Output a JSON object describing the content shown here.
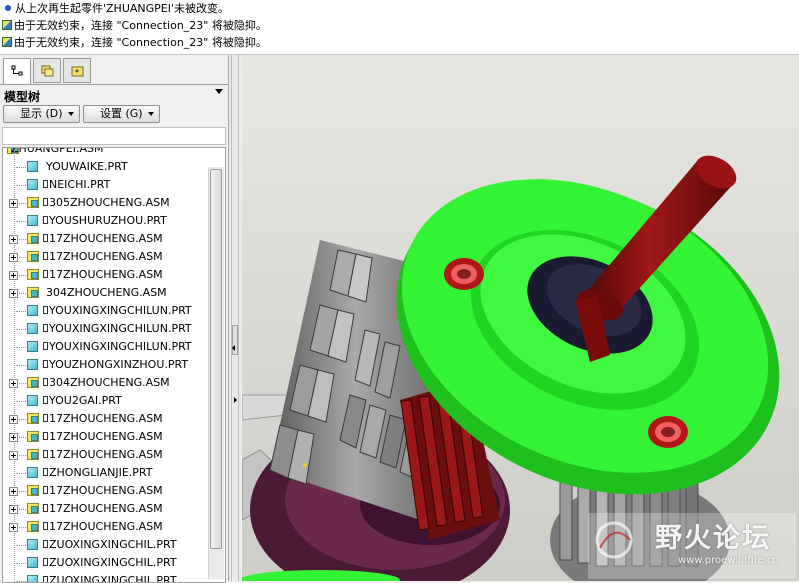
{
  "messages": [
    {
      "text": "从上次再生起零件'ZHUANGPEI'未被改变。",
      "icon": "info-dot-icon"
    },
    {
      "text": "由于无效约束，连接 \"Connection_23\" 将被隐抑。",
      "icon": "warning-icon"
    },
    {
      "text": "由于无效约束，连接 \"Connection_23\" 将被隐抑。",
      "icon": "warning-icon"
    }
  ],
  "navigator": {
    "tabs": [
      {
        "icon": "model-tree-icon",
        "active": true
      },
      {
        "icon": "folder-browser-icon",
        "active": false
      },
      {
        "icon": "favorites-icon",
        "active": false
      }
    ]
  },
  "model_tree": {
    "title": "模型树",
    "show_button": "显示 (D)",
    "settings_button": "设置 (G)",
    "root": "ZHUANGPEI.ASM",
    "items": [
      {
        "label": "YOUWAIKE.PRT",
        "type": "prt",
        "expandable": false,
        "marked": false
      },
      {
        "label": "NEICHI.PRT",
        "type": "prt",
        "expandable": false,
        "marked": true
      },
      {
        "label": "305ZHOUCHENG.ASM",
        "type": "asm",
        "expandable": true,
        "marked": true
      },
      {
        "label": "YOUSHURUZHOU.PRT",
        "type": "prt",
        "expandable": false,
        "marked": true
      },
      {
        "label": "17ZHOUCHENG.ASM",
        "type": "asm",
        "expandable": true,
        "marked": true
      },
      {
        "label": "17ZHOUCHENG.ASM",
        "type": "asm",
        "expandable": true,
        "marked": true
      },
      {
        "label": "17ZHOUCHENG.ASM",
        "type": "asm",
        "expandable": true,
        "marked": true
      },
      {
        "label": "304ZHOUCHENG.ASM",
        "type": "asm",
        "expandable": true,
        "marked": false
      },
      {
        "label": "YOUXINGXINGCHILUN.PRT",
        "type": "prt",
        "expandable": false,
        "marked": true
      },
      {
        "label": "YOUXINGXINGCHILUN.PRT",
        "type": "prt",
        "expandable": false,
        "marked": true
      },
      {
        "label": "YOUXINGXINGCHILUN.PRT",
        "type": "prt",
        "expandable": false,
        "marked": true
      },
      {
        "label": "YOUZHONGXINZHOU.PRT",
        "type": "prt",
        "expandable": false,
        "marked": true
      },
      {
        "label": "304ZHOUCHENG.ASM",
        "type": "asm",
        "expandable": true,
        "marked": true
      },
      {
        "label": "YOU2GAI.PRT",
        "type": "prt",
        "expandable": false,
        "marked": true
      },
      {
        "label": "17ZHOUCHENG.ASM",
        "type": "asm",
        "expandable": true,
        "marked": true
      },
      {
        "label": "17ZHOUCHENG.ASM",
        "type": "asm",
        "expandable": true,
        "marked": true
      },
      {
        "label": "17ZHOUCHENG.ASM",
        "type": "asm",
        "expandable": true,
        "marked": true
      },
      {
        "label": "ZHONGLIANJIE.PRT",
        "type": "prt",
        "expandable": false,
        "marked": true
      },
      {
        "label": "17ZHOUCHENG.ASM",
        "type": "asm",
        "expandable": true,
        "marked": true
      },
      {
        "label": "17ZHOUCHENG.ASM",
        "type": "asm",
        "expandable": true,
        "marked": true
      },
      {
        "label": "17ZHOUCHENG.ASM",
        "type": "asm",
        "expandable": true,
        "marked": true
      },
      {
        "label": "ZUOXINGXINGCHIL.PRT",
        "type": "prt",
        "expandable": false,
        "marked": true
      },
      {
        "label": "ZUOXINGXINGCHIL.PRT",
        "type": "prt",
        "expandable": false,
        "marked": true
      },
      {
        "label": "ZUOXINGXINGCHIL.PRT",
        "type": "prt",
        "expandable": false,
        "marked": true
      }
    ]
  },
  "watermark": {
    "text": "野火论坛",
    "url": "www.proewildfire.cn"
  },
  "colors": {
    "flange": "#2df22d",
    "shaft": "#8a1010",
    "gear": "#8c8c8c",
    "housing": "#5a2040",
    "bolt": "#e03030",
    "background_top": "#e4e4e0",
    "background_bottom": "#cfcfca"
  }
}
